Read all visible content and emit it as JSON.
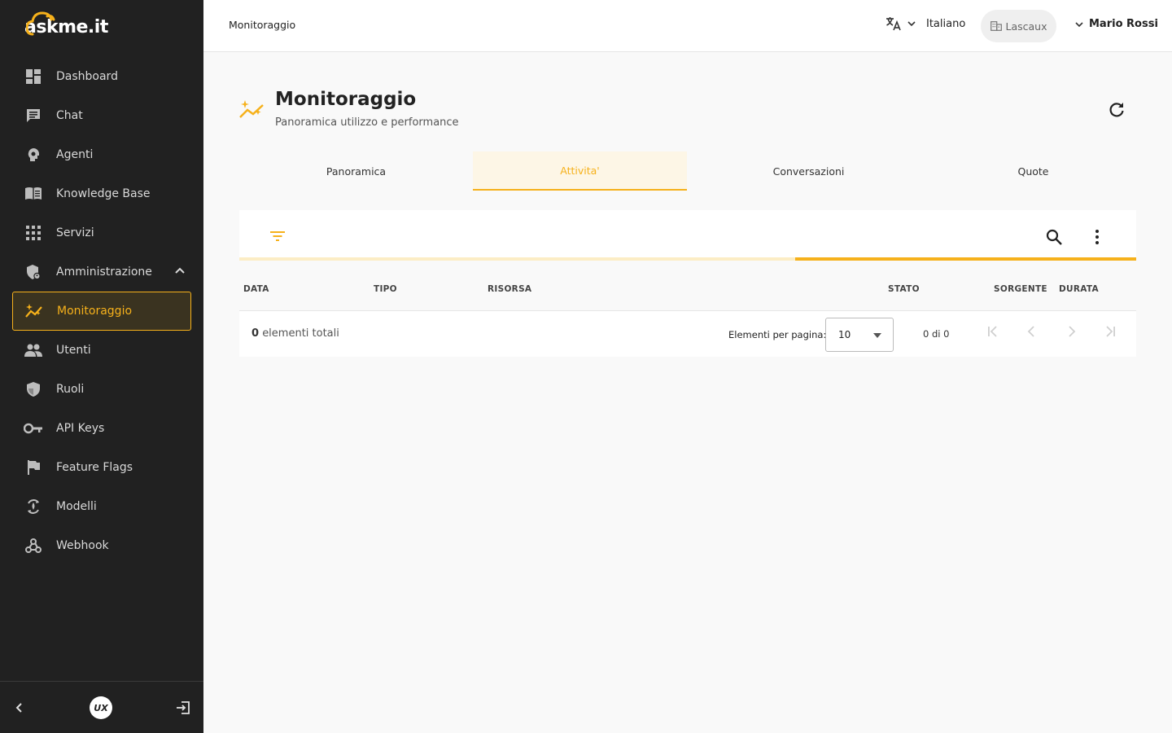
{
  "app": {
    "name": "askme.it"
  },
  "sidebar": {
    "items": [
      {
        "label": "Dashboard",
        "icon": "dashboard-icon"
      },
      {
        "label": "Chat",
        "icon": "chat-icon"
      },
      {
        "label": "Agenti",
        "icon": "agent-icon"
      },
      {
        "label": "Knowledge Base",
        "icon": "book-icon"
      },
      {
        "label": "Servizi",
        "icon": "apps-grid-icon"
      },
      {
        "label": "Amministrazione",
        "icon": "admin-shield-icon",
        "expanded": true
      },
      {
        "label": "Monitoraggio",
        "icon": "monitoring-icon",
        "active": true
      },
      {
        "label": "Utenti",
        "icon": "users-icon"
      },
      {
        "label": "Ruoli",
        "icon": "shield-icon"
      },
      {
        "label": "API Keys",
        "icon": "key-icon"
      },
      {
        "label": "Feature Flags",
        "icon": "flag-icon"
      },
      {
        "label": "Modelli",
        "icon": "model-icon"
      },
      {
        "label": "Webhook",
        "icon": "webhook-icon"
      }
    ],
    "footer": {
      "badge": "UX"
    }
  },
  "topbar": {
    "breadcrumb": "Monitoraggio",
    "language": "Italiano",
    "tenant": "Lascaux",
    "user": "Mario Rossi"
  },
  "header": {
    "title": "Monitoraggio",
    "subtitle": "Panoramica utilizzo e performance"
  },
  "tabs": [
    {
      "label": "Panoramica"
    },
    {
      "label": "Attivita'",
      "active": true
    },
    {
      "label": "Conversazioni"
    },
    {
      "label": "Quote"
    }
  ],
  "table": {
    "loading_progress": 0.38,
    "columns": [
      "DATA",
      "TIPO",
      "RISORSA",
      "STATO",
      "SORGENTE",
      "DURATA"
    ],
    "rows": [],
    "total_count": "0",
    "total_label": "elementi totali",
    "per_page_label": "Elementi per pagina:",
    "per_page": "10",
    "range": "0 di 0"
  },
  "colors": {
    "accent": "#f6b11b",
    "sidebar_bg": "#212121",
    "active_bg": "#3a3320"
  }
}
